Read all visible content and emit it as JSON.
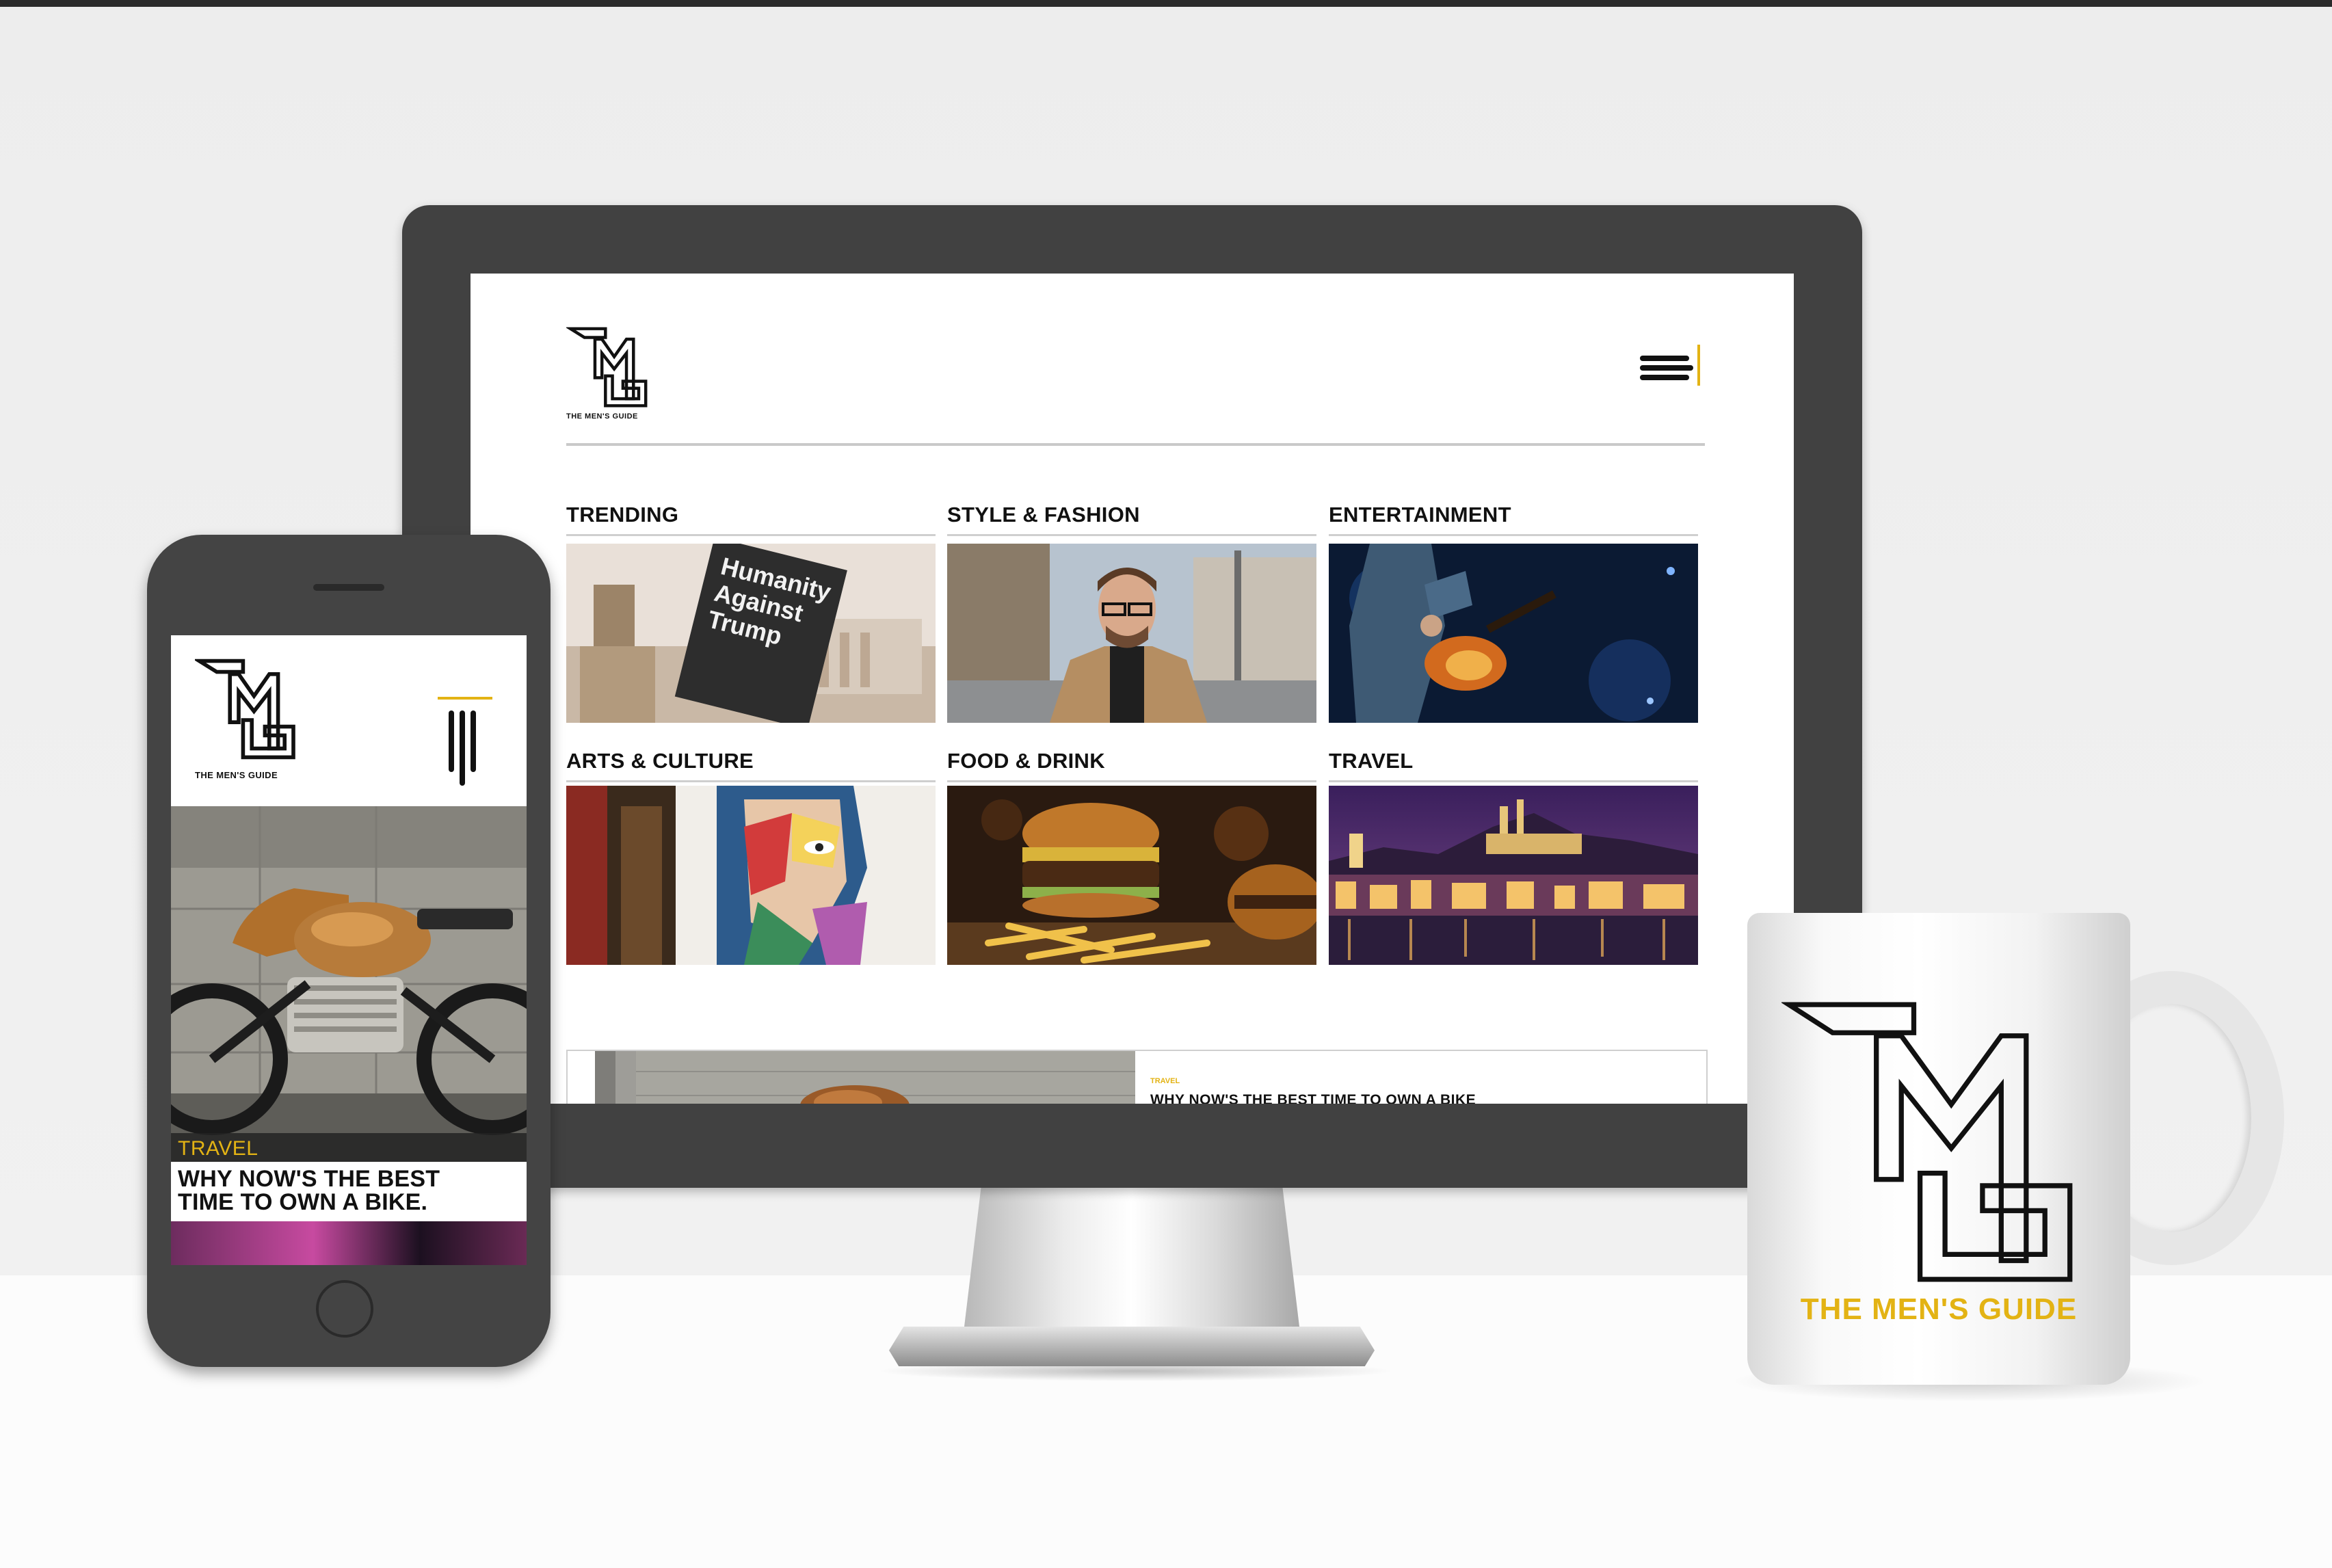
{
  "brand": {
    "name": "THE MEN'S GUIDE",
    "accent_color": "#e3b314",
    "logo_icon": "tmg-monogram-icon"
  },
  "desktop": {
    "menu_icon": "hamburger-menu-icon",
    "categories": [
      {
        "label": "TRENDING",
        "image": "protest-sign-photo"
      },
      {
        "label": "STYLE & FASHION",
        "image": "man-in-glasses-photo"
      },
      {
        "label": "ENTERTAINMENT",
        "image": "guitarist-on-stage-photo"
      },
      {
        "label": "ARTS & CULTURE",
        "image": "street-mural-photo"
      },
      {
        "label": "FOOD & DRINK",
        "image": "burger-and-fries-photo"
      },
      {
        "label": "TRAVEL",
        "image": "city-castle-night-photo"
      }
    ],
    "trending_sign_text": "Humanity Against Trump",
    "feature": {
      "tag": "TRAVEL",
      "headline": "WHY NOW'S THE BEST TIME TO OWN A BIKE"
    }
  },
  "mobile": {
    "menu_icon": "vertical-bars-menu-icon",
    "hero_image": "vintage-motorcycle-photo",
    "tag": "TRAVEL",
    "headline": "WHY NOW'S THE BEST\nTIME TO OWN A BIKE."
  },
  "mug": {
    "brand_text": "THE MEN'S GUIDE"
  }
}
